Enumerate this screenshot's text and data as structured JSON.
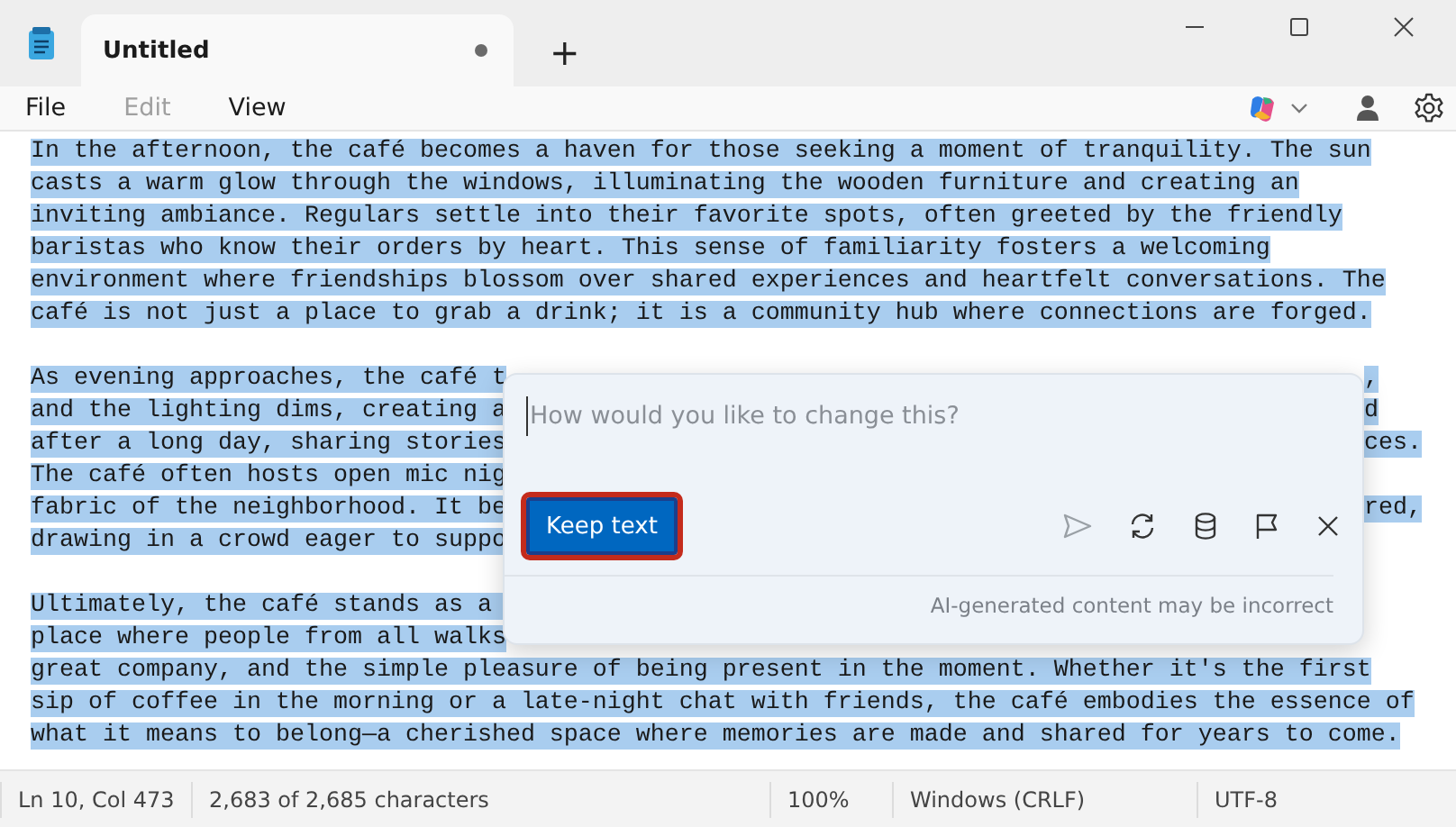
{
  "window": {
    "tab": {
      "title": "Untitled",
      "unsaved": true
    },
    "new_tab": "+"
  },
  "menu": [
    {
      "label": "File",
      "disabled": false
    },
    {
      "label": "Edit",
      "disabled": true
    },
    {
      "label": "View",
      "disabled": false
    }
  ],
  "document": {
    "selected": true,
    "lines": [
      {
        "kind": "text",
        "text": "In the afternoon, the café becomes a haven for those seeking a moment of tranquility. The sun"
      },
      {
        "kind": "text",
        "text": "casts a warm glow through the windows, illuminating the wooden furniture and creating an"
      },
      {
        "kind": "text",
        "text": "inviting ambiance. Regulars settle into their favorite spots, often greeted by the friendly"
      },
      {
        "kind": "text",
        "text": "baristas who know their orders by heart. This sense of familiarity fosters a welcoming"
      },
      {
        "kind": "text",
        "text": "environment where friendships blossom over shared experiences and heartfelt conversations. The"
      },
      {
        "kind": "text",
        "text": "café is not just a place to grab a drink; it is a community hub where connections are forged."
      },
      {
        "kind": "blank"
      },
      {
        "kind": "covered",
        "text": "As evening approaches, the café t",
        "right": ","
      },
      {
        "kind": "covered",
        "text": "and the lighting dims, creating a",
        "right": "d"
      },
      {
        "kind": "covered",
        "text": "after a long day, sharing stories",
        "right": "ces."
      },
      {
        "kind": "covered",
        "text": "The café often hosts open mic nig"
      },
      {
        "kind": "covered",
        "text": "fabric of the neighborhood. It be",
        "right": "red,"
      },
      {
        "kind": "covered",
        "text": "drawing in a crowd eager to suppo"
      },
      {
        "kind": "blank"
      },
      {
        "kind": "covered",
        "text": "Ultimately, the café stands as a "
      },
      {
        "kind": "covered",
        "text": "place where people from all walks"
      },
      {
        "kind": "text",
        "text": "great company, and the simple pleasure of being present in the moment. Whether it's the first"
      },
      {
        "kind": "text",
        "text": "sip of coffee in the morning or a late-night chat with friends, the café embodies the essence of"
      },
      {
        "kind": "text",
        "text": "what it means to belong—a cherished space where memories are made and shared for years to come."
      }
    ]
  },
  "rewrite_popup": {
    "placeholder": "How would you like to change this?",
    "keep_button": "Keep text",
    "disclaimer": "AI-generated content may be incorrect"
  },
  "status_bar": {
    "position": "Ln 10, Col 473",
    "characters": "2,683 of 2,685 characters",
    "zoom": "100%",
    "line_ending": "Windows (CRLF)",
    "encoding": "UTF-8"
  }
}
